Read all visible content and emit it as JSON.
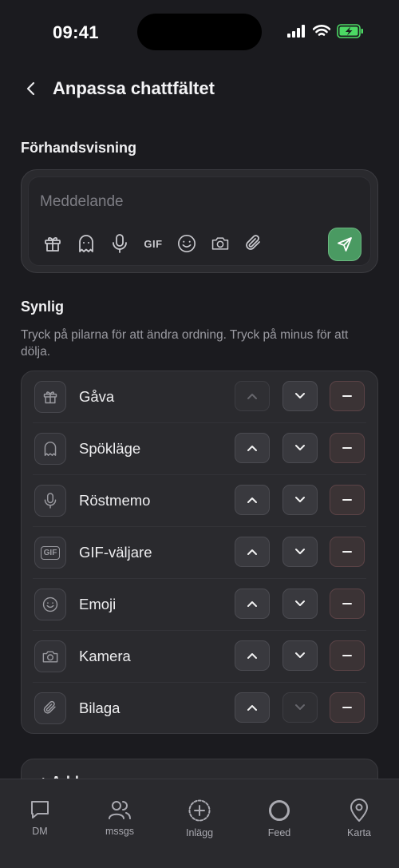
{
  "status": {
    "time": "09:41"
  },
  "header": {
    "title": "Anpassa chattfältet"
  },
  "preview": {
    "section_title": "Förhandsvisning",
    "placeholder": "Meddelande",
    "gif_label": "GIF"
  },
  "visible": {
    "section_title": "Synlig",
    "hint": "Tryck på pilarna för att ändra ordning. Tryck på minus för att dölja.",
    "items": [
      {
        "label": "Gåva",
        "icon": "gift-icon"
      },
      {
        "label": "Spökläge",
        "icon": "ghost-icon"
      },
      {
        "label": "Röstmemo",
        "icon": "microphone-icon"
      },
      {
        "label": "GIF-väljare",
        "icon": "gif-icon",
        "icon_text": "GIF"
      },
      {
        "label": "Emoji",
        "icon": "emoji-icon"
      },
      {
        "label": "Kamera",
        "icon": "camera-icon"
      },
      {
        "label": "Bilaga",
        "icon": "paperclip-icon"
      }
    ]
  },
  "add_section": {
    "label": "+ Add"
  },
  "tabs": [
    {
      "label": "DM",
      "icon": "chat-bubble-icon"
    },
    {
      "label": "mssgs",
      "icon": "people-icon"
    },
    {
      "label": "Inlägg",
      "icon": "plus-circle-icon"
    },
    {
      "label": "Feed",
      "icon": "ring-icon"
    },
    {
      "label": "Karta",
      "icon": "map-pin-icon"
    }
  ],
  "colors": {
    "background": "#1b1b1f",
    "card": "#2a2a2e",
    "send_button": "#4a9a62",
    "battery": "#4cd964"
  }
}
